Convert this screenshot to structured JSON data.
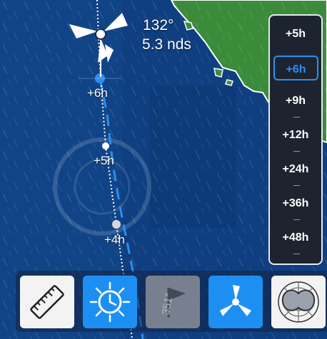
{
  "readout": {
    "heading": "132°",
    "speed": "5.3 nds"
  },
  "track_labels": [
    "+6h",
    "+5h",
    "+4h"
  ],
  "time_panel": {
    "items": [
      "+5h",
      "+6h",
      "+9h",
      "+12h",
      "+24h",
      "+36h",
      "+48h"
    ],
    "selected": "+6h"
  },
  "toolbar": {
    "buttons": [
      {
        "name": "ruler-button",
        "icon": "ruler-icon"
      },
      {
        "name": "time-sun-button",
        "icon": "sun-clock-icon"
      },
      {
        "name": "waypoint-flag-button",
        "icon": "flag-icon",
        "label": "351°"
      },
      {
        "name": "wind-button",
        "icon": "wind-turbine-icon"
      },
      {
        "name": "polar-diagram-button",
        "icon": "polar-diagram-icon"
      }
    ]
  },
  "colors": {
    "sea": "#0f3f80",
    "land": "#3a8c3a",
    "accent": "#2b8ff0",
    "panel": "#1d2430"
  }
}
